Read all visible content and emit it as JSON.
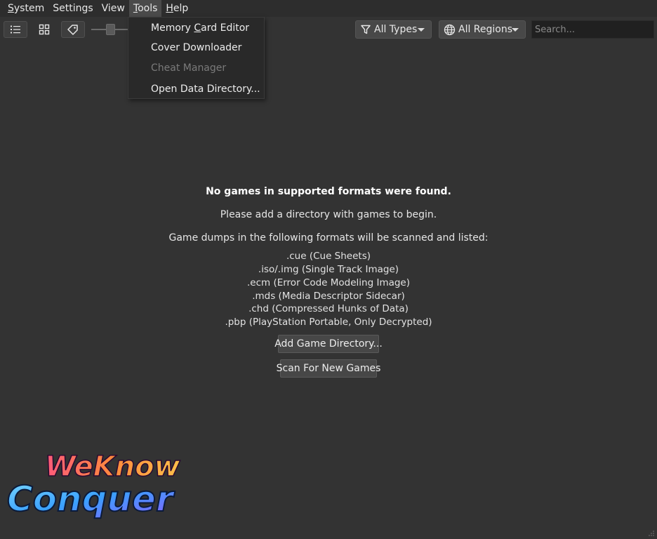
{
  "menubar": {
    "items": [
      {
        "mnemonic": "S",
        "rest": "ystem"
      },
      {
        "mnemonic": "",
        "rest": "Settings"
      },
      {
        "mnemonic": "",
        "rest": "View"
      },
      {
        "mnemonic": "T",
        "rest": "ools"
      },
      {
        "mnemonic": "H",
        "rest": "elp"
      }
    ]
  },
  "toolbar": {
    "type_filter": "All Types",
    "region_filter": "All Regions",
    "search_placeholder": "Search..."
  },
  "tools_menu": {
    "items": [
      {
        "pre": "Memory ",
        "mnemonic": "C",
        "post": "ard Editor",
        "enabled": true
      },
      {
        "pre": "Cover Downloader",
        "mnemonic": "",
        "post": "",
        "enabled": true
      },
      {
        "pre": "Cheat Manager",
        "mnemonic": "",
        "post": "",
        "enabled": false
      },
      {
        "pre": "Open Data Directory...",
        "mnemonic": "",
        "post": "",
        "enabled": true
      }
    ]
  },
  "empty_state": {
    "title": "No games in supported formats were found.",
    "subtitle": "Please add a directory with games to begin.",
    "formats_intro": "Game dumps in the following formats will be scanned and listed:",
    "formats": [
      ".cue (Cue Sheets)",
      ".iso/.img (Single Track Image)",
      ".ecm (Error Code Modeling Image)",
      ".mds (Media Descriptor Sidecar)",
      ".chd (Compressed Hunks of Data)",
      ".pbp (PlayStation Portable, Only Decrypted)"
    ],
    "add_button": "Add Game Directory...",
    "scan_button": "Scan For New Games"
  },
  "watermark": {
    "line1": "WeKnow",
    "line2": "Conquer"
  },
  "colors": {
    "background": "#333333",
    "menubar": "#2d2d2d",
    "dropdown": "#292929",
    "disabled_text": "#7a7a7a"
  }
}
